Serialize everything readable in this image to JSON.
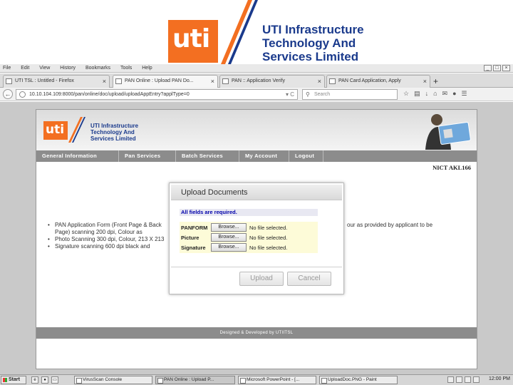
{
  "slide": {
    "logo_text": "uti",
    "company_line1": "UTI Infrastructure",
    "company_line2": "Technology And",
    "company_line3": "Services Limited",
    "brand_orange": "#f36f21",
    "brand_blue": "#1a3a8c"
  },
  "browser": {
    "menu": [
      "File",
      "Edit",
      "View",
      "History",
      "Bookmarks",
      "Tools",
      "Help"
    ],
    "window_controls": [
      "_",
      "□",
      "×"
    ],
    "tabs": [
      {
        "label": "UTI TSL : Untitled - Firefox"
      },
      {
        "label": "PAN Online : Upload PAN Do..."
      },
      {
        "label": "PAN :: Application Verify"
      },
      {
        "label": "PAN Card Application, Apply"
      }
    ],
    "new_tab": "+",
    "url": "10.10.104.109:8000/pan/online/doc/upload/uploadAppEntry?applType=0",
    "search_placeholder": "Search"
  },
  "site": {
    "logo_text": "uti",
    "name_line1": "UTI Infrastructure",
    "name_line2": "Technology And",
    "name_line3": "Services Limited",
    "nav": [
      "General Information",
      "Pan Services",
      "Batch Services",
      "My Account",
      "Logout"
    ],
    "user_id": "NICT  AKL166",
    "bullets": [
      "PAN Application Form (Front Page & Back Page) scanning 200 dpi, Colour as provided by applicant to be scanned to 200dpi color - PDF/A format",
      "Photo Scanning 300 dpi, Colour, 213 X 213 px",
      "Signature scanning 600 dpi black and white"
    ],
    "bullet_tail": "our as provided by applicant to be",
    "footer": "Designed & Developed by UTIITSL"
  },
  "modal": {
    "title": "Upload Documents",
    "required_note": "All fields are required.",
    "fields": [
      {
        "label": "PANFORM",
        "button": "Browse...",
        "status": "No file selected."
      },
      {
        "label": "Picture",
        "button": "Browse...",
        "status": "No file selected."
      },
      {
        "label": "Signature",
        "button": "Browse...",
        "status": "No file selected."
      }
    ],
    "upload_label": "Upload",
    "cancel_label": "Cancel"
  },
  "taskbar": {
    "start": "Start",
    "tasks": [
      {
        "label": "VirusScan Console"
      },
      {
        "label": "PAN Online : Upload P..."
      },
      {
        "label": "Microsoft PowerPoint - [..."
      },
      {
        "label": "UploadDoc.PNG - Paint"
      }
    ],
    "clock": "12:00 PM"
  }
}
